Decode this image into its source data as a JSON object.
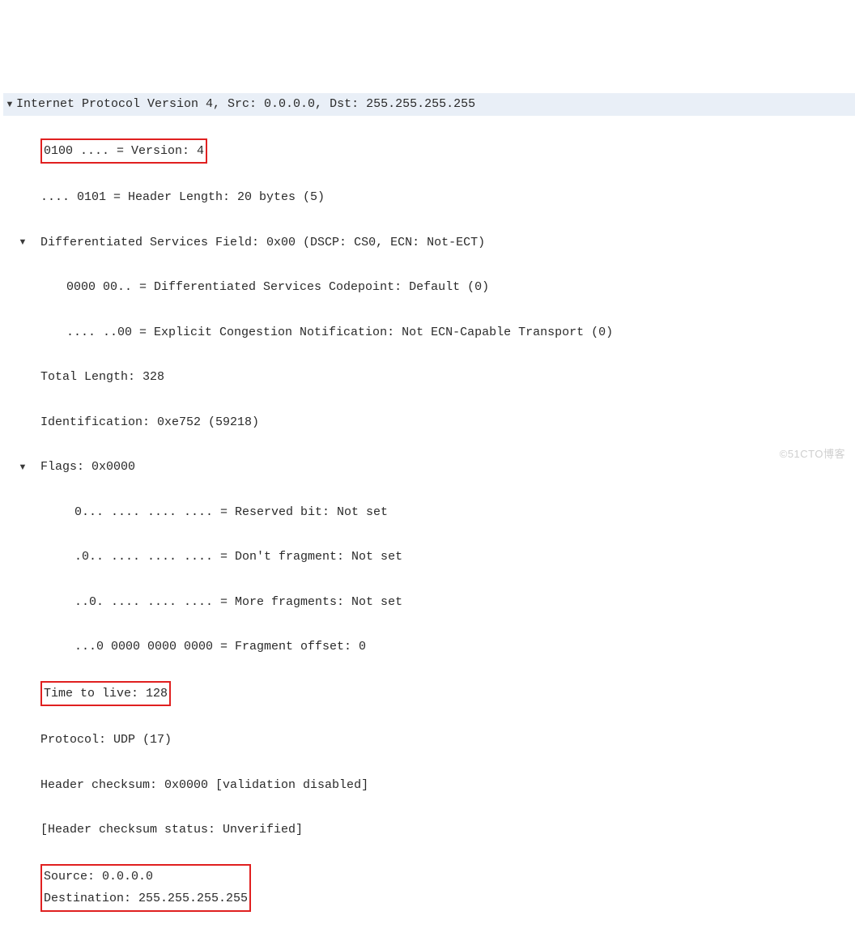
{
  "packet": {
    "header": "Internet Protocol Version 4, Src: 0.0.0.0, Dst: 255.255.255.255",
    "version": "0100 .... = Version: 4",
    "header_length": ".... 0101 = Header Length: 20 bytes (5)",
    "diff_services_header": "Differentiated Services Field: 0x00 (DSCP: CS0, ECN: Not-ECT)",
    "dscp": "0000 00.. = Differentiated Services Codepoint: Default (0)",
    "ecn": ".... ..00 = Explicit Congestion Notification: Not ECN-Capable Transport (0)",
    "total_length": "Total Length: 328",
    "identification": "Identification: 0xe752 (59218)",
    "flags_header": "Flags: 0x0000",
    "flag_reserved": "0... .... .... .... = Reserved bit: Not set",
    "flag_dont_fragment": ".0.. .... .... .... = Don't fragment: Not set",
    "flag_more_fragments": "..0. .... .... .... = More fragments: Not set",
    "fragment_offset": "...0 0000 0000 0000 = Fragment offset: 0",
    "ttl": "Time to live: 128",
    "protocol": "Protocol: UDP (17)",
    "checksum": "Header checksum: 0x0000 [validation disabled]",
    "checksum_status": "[Header checksum status: Unverified]",
    "source": "Source: 0.0.0.0",
    "destination": "Destination: 255.255.255.255"
  },
  "watermark": "©51CTO博客"
}
